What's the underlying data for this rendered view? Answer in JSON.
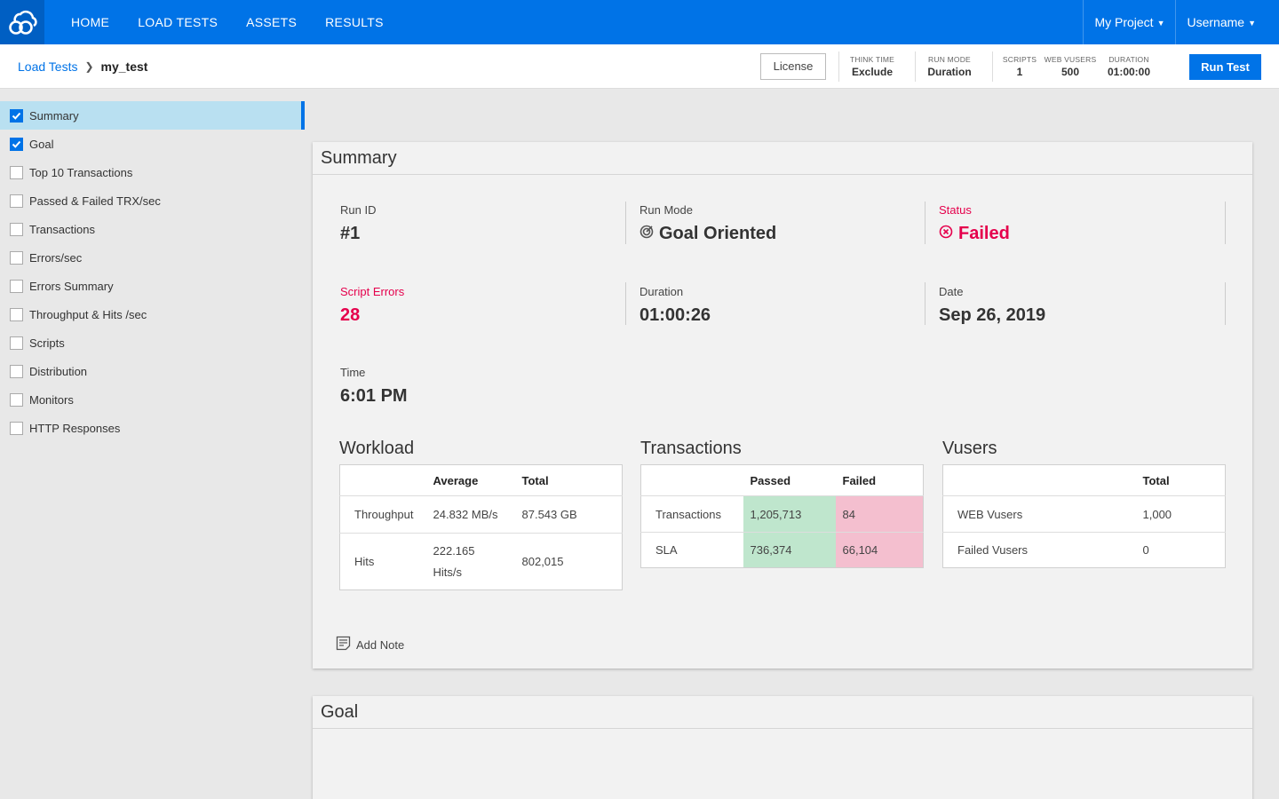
{
  "nav": {
    "items": [
      "HOME",
      "LOAD TESTS",
      "ASSETS",
      "RESULTS"
    ],
    "project": "My Project",
    "user": "Username"
  },
  "subbar": {
    "crumb_parent": "Load Tests",
    "crumb_current": "my_test",
    "license": "License",
    "stats": [
      {
        "label": "THINK TIME",
        "value": "Exclude"
      },
      {
        "label": "RUN MODE",
        "value": "Duration"
      },
      {
        "label": "SCRIPTS",
        "value": "1"
      },
      {
        "label": "WEB VUSERS",
        "value": "500"
      },
      {
        "label": "DURATION",
        "value": "01:00:00"
      }
    ],
    "run_test": "Run Test"
  },
  "sidebar": {
    "items": [
      {
        "label": "Summary",
        "checked": true
      },
      {
        "label": "Goal",
        "checked": true
      },
      {
        "label": "Top 10 Transactions",
        "checked": false
      },
      {
        "label": "Passed & Failed TRX/sec",
        "checked": false
      },
      {
        "label": "Transactions",
        "checked": false
      },
      {
        "label": "Errors/sec",
        "checked": false
      },
      {
        "label": "Errors Summary",
        "checked": false
      },
      {
        "label": "Throughput & Hits /sec",
        "checked": false
      },
      {
        "label": "Scripts",
        "checked": false
      },
      {
        "label": "Distribution",
        "checked": false
      },
      {
        "label": "Monitors",
        "checked": false
      },
      {
        "label": "HTTP Responses",
        "checked": false
      }
    ]
  },
  "summary": {
    "title": "Summary",
    "run_id": {
      "label": "Run ID",
      "value": "#1"
    },
    "run_mode": {
      "label": "Run Mode",
      "value": "Goal Oriented"
    },
    "status": {
      "label": "Status",
      "value": "Failed"
    },
    "script_errors": {
      "label": "Script Errors",
      "value": "28"
    },
    "duration": {
      "label": "Duration",
      "value": "01:00:26"
    },
    "date": {
      "label": "Date",
      "value": "Sep 26, 2019"
    },
    "time": {
      "label": "Time",
      "value": "6:01 PM"
    },
    "workload": {
      "title": "Workload",
      "headers": [
        "Average",
        "Total"
      ],
      "rows": [
        {
          "name": "Throughput",
          "average": "24.832 MB/s",
          "total": "87.543 GB"
        },
        {
          "name": "Hits",
          "average": "222.165 Hits/s",
          "total": "802,015"
        }
      ]
    },
    "transactions": {
      "title": "Transactions",
      "headers": [
        "Passed",
        "Failed"
      ],
      "rows": [
        {
          "name": "Transactions",
          "passed": "1,205,713",
          "failed": "84"
        },
        {
          "name": "SLA",
          "passed": "736,374",
          "failed": "66,104"
        }
      ]
    },
    "vusers": {
      "title": "Vusers",
      "headers": [
        "Total"
      ],
      "rows": [
        {
          "name": "WEB Vusers",
          "total": "1,000"
        },
        {
          "name": "Failed Vusers",
          "total": "0"
        }
      ]
    },
    "add_note": "Add Note"
  },
  "goal": {
    "title": "Goal"
  },
  "colors": {
    "brand": "#0073e7",
    "failed": "#e5004c",
    "passed_cell": "#bfe6cd",
    "failed_cell": "#f4bfcf"
  }
}
